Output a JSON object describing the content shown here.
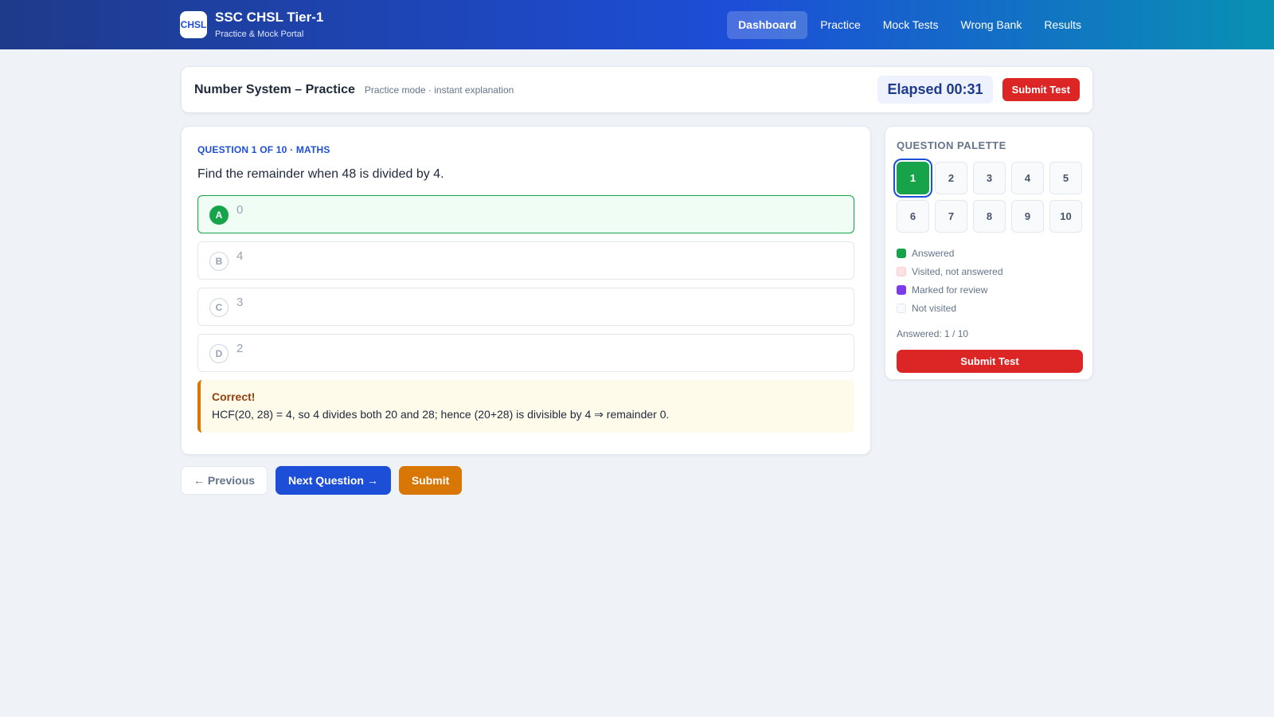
{
  "header": {
    "logo_text": "CHSL",
    "title": "SSC CHSL Tier-1",
    "subtitle": "Practice & Mock Portal",
    "nav": [
      {
        "label": "Dashboard",
        "active": true
      },
      {
        "label": "Practice"
      },
      {
        "label": "Mock Tests"
      },
      {
        "label": "Wrong Bank"
      },
      {
        "label": "Results"
      }
    ]
  },
  "test": {
    "title": "Number System – Practice",
    "mode": "Practice mode · instant explanation",
    "elapsed": "Elapsed 00:31",
    "submit_label": "Submit Test"
  },
  "question": {
    "meta": "QUESTION 1 OF 10 · MATHS",
    "text": "Find the remainder when 48 is divided by 4.",
    "options": [
      {
        "letter": "A",
        "text": "0",
        "state": "correct"
      },
      {
        "letter": "B",
        "text": "4"
      },
      {
        "letter": "C",
        "text": "3"
      },
      {
        "letter": "D",
        "text": "2"
      }
    ],
    "explanation": {
      "title": "Correct!",
      "text": "HCF(20, 28) = 4, so 4 divides both 20 and 28; hence (20+28) is divisible by 4 ⇒ remainder 0."
    }
  },
  "actions": {
    "previous": "← Previous",
    "next": "Next Question →",
    "submit": "Submit"
  },
  "palette": {
    "title": "QUESTION PALETTE",
    "numbers": [
      "1",
      "2",
      "3",
      "4",
      "5",
      "6",
      "7",
      "8",
      "9",
      "10"
    ],
    "legend": {
      "answered": "Answered",
      "visited": "Visited, not answered",
      "review": "Marked for review",
      "not_visited": "Not visited"
    },
    "answered_count": "Answered: 1 / 10",
    "submit_label": "Submit Test"
  },
  "colors": {
    "primary": "#1d4ed8",
    "success": "#16a34a",
    "danger": "#dc2626",
    "warning": "#d97706",
    "review": "#7c3aed"
  }
}
